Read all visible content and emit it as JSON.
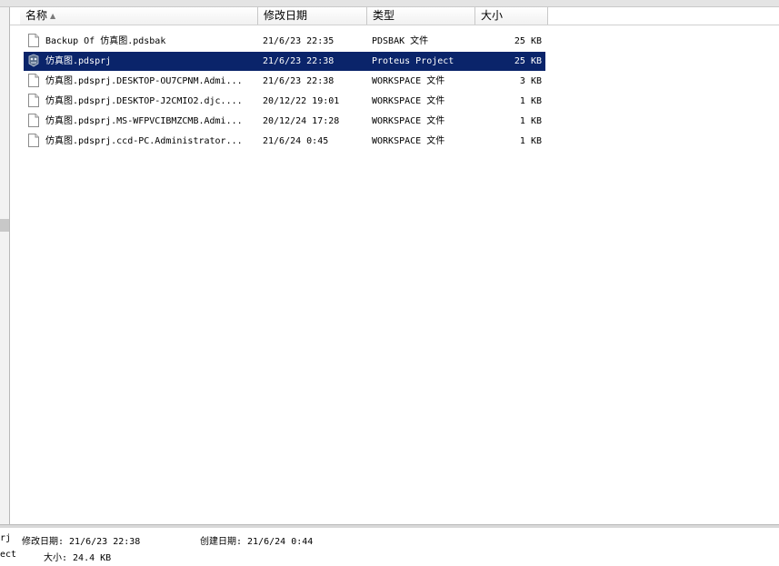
{
  "columns": {
    "name": "名称",
    "date": "修改日期",
    "type": "类型",
    "size": "大小"
  },
  "files": [
    {
      "name": "Backup Of 仿真图.pdsbak",
      "date": "21/6/23 22:35",
      "type": "PDSBAK 文件",
      "size": "25 KB",
      "icon": "document-icon"
    },
    {
      "name": "仿真图.pdsprj",
      "date": "21/6/23 22:38",
      "type": "Proteus Project",
      "size": "25 KB",
      "icon": "proteus-project-icon",
      "selected": true
    },
    {
      "name": "仿真图.pdsprj.DESKTOP-OU7CPNM.Admi...",
      "date": "21/6/23 22:38",
      "type": "WORKSPACE 文件",
      "size": "3 KB",
      "icon": "document-icon"
    },
    {
      "name": "仿真图.pdsprj.DESKTOP-J2CMIO2.djc....",
      "date": "20/12/22 19:01",
      "type": "WORKSPACE 文件",
      "size": "1 KB",
      "icon": "document-icon"
    },
    {
      "name": "仿真图.pdsprj.MS-WFPVCIBMZCMB.Admi...",
      "date": "20/12/24 17:28",
      "type": "WORKSPACE 文件",
      "size": "1 KB",
      "icon": "document-icon"
    },
    {
      "name": "仿真图.pdsprj.ccd-PC.Administrator...",
      "date": "21/6/24 0:45",
      "type": "WORKSPACE 文件",
      "size": "1 KB",
      "icon": "document-icon"
    }
  ],
  "details": {
    "name_fragment": "rj",
    "modified": "修改日期: 21/6/23 22:38",
    "created": "创建日期: 21/6/24 0:44",
    "type_fragment": "ect",
    "size": "大小: 24.4 KB"
  },
  "colors": {
    "selection": "#0a246a",
    "selection_text": "#ffffff"
  }
}
